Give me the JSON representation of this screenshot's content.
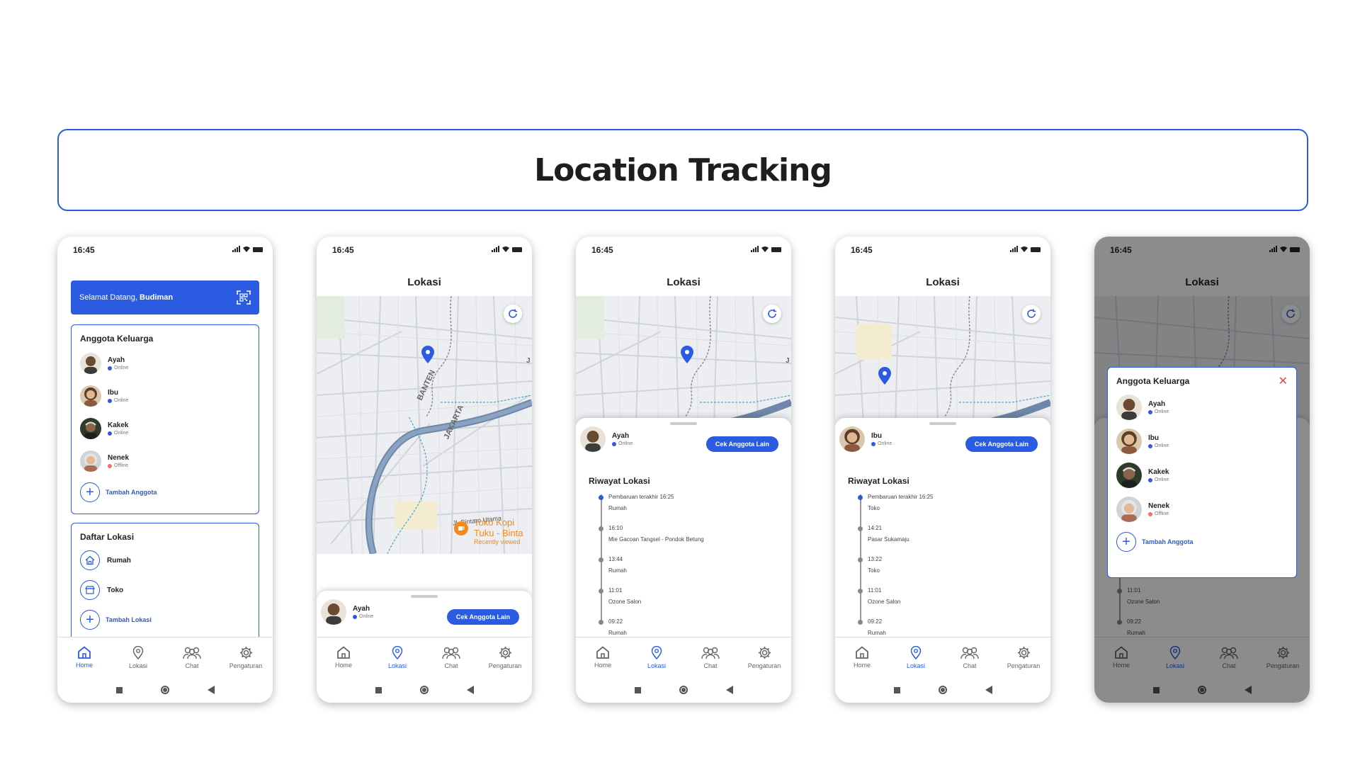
{
  "banner": {
    "title": "Location Tracking"
  },
  "status": {
    "time": "16:45"
  },
  "app": {
    "lokasi_title": "Lokasi"
  },
  "home": {
    "welcome_prefix": "Selamat Datang,",
    "welcome_name": "Budiman",
    "family_title": "Anggota Keluarga",
    "members": [
      {
        "name": "Ayah",
        "status": "Online"
      },
      {
        "name": "Ibu",
        "status": "Online"
      },
      {
        "name": "Kakek",
        "status": "Online"
      },
      {
        "name": "Nenek",
        "status": "Offline"
      }
    ],
    "add_member": "Tambah Anggota",
    "locations_title": "Daftar Lokasi",
    "locations": [
      {
        "name": "Rumah",
        "icon": "home-icon"
      },
      {
        "name": "Toko",
        "icon": "store-icon"
      }
    ],
    "add_location": "Tambah Lokasi"
  },
  "nav": {
    "home": "Home",
    "lokasi": "Lokasi",
    "chat": "Chat",
    "settings": "Pengaturan"
  },
  "map": {
    "street_1": "BANTEN",
    "street_2": "JAKARTA",
    "poi_line1": "Toko Kopi",
    "poi_line2": "Tuku - Binta",
    "poi_line3": "Recently viewed",
    "road_label": "Jl. Bintaro Utama",
    "edge_letter": "J"
  },
  "sheet": {
    "cek_button": "Cek Anggota Lain",
    "history_title": "Riwayat Lokasi"
  },
  "ayah": {
    "name": "Ayah",
    "status": "Online",
    "history": [
      {
        "time": "Pembaruan terakhir 16:25",
        "place": "Rumah"
      },
      {
        "time": "16:10",
        "place": "Mie Gacoan Tangsel - Pondok Betung"
      },
      {
        "time": "13:44",
        "place": "Rumah"
      },
      {
        "time": "11:01",
        "place": "Ozone Salon"
      },
      {
        "time": "09:22",
        "place": "Rumah"
      }
    ]
  },
  "ibu": {
    "name": "Ibu",
    "status": "Online",
    "history": [
      {
        "time": "Pembaruan terakhir 16:25",
        "place": "Toko"
      },
      {
        "time": "14:21",
        "place": "Pasar Sukamaju"
      },
      {
        "time": "13:22",
        "place": "Toko"
      },
      {
        "time": "11:01",
        "place": "Ozone Salon"
      },
      {
        "time": "09:22",
        "place": "Rumah"
      }
    ]
  },
  "modal": {
    "title": "Anggota Keluarga"
  },
  "colors": {
    "accent": "#2a5be0",
    "online": "#2a5be0",
    "offline": "#f07070"
  }
}
